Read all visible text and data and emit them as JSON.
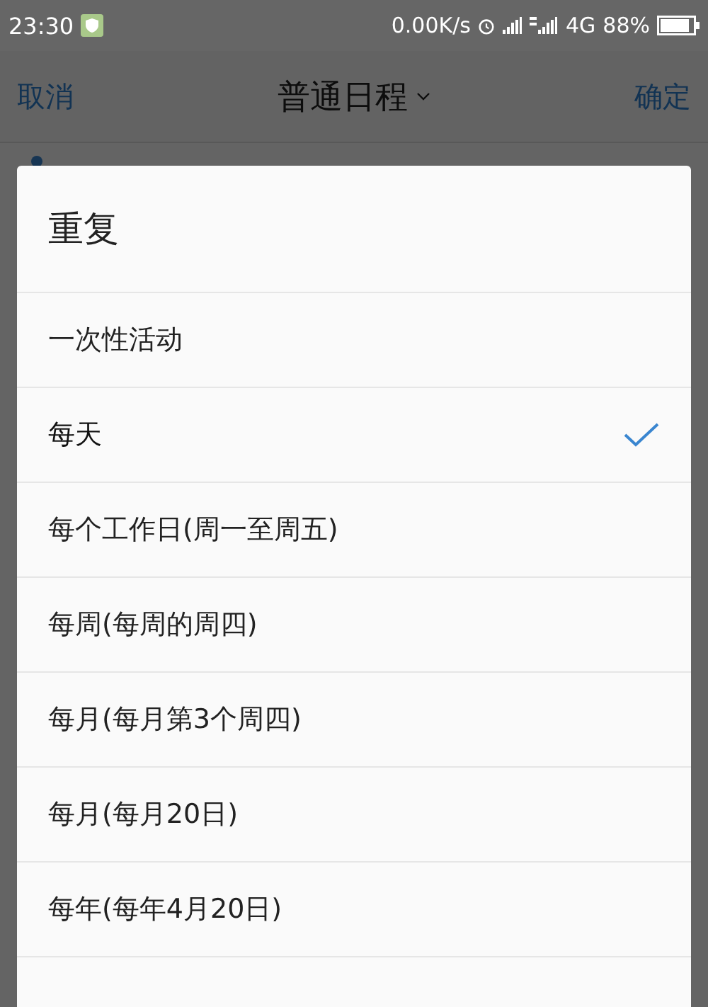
{
  "status_bar": {
    "time": "23:30",
    "net_speed": "0.00K/s",
    "network": "4G",
    "battery": "88%"
  },
  "header": {
    "cancel": "取消",
    "title": "普通日程",
    "confirm": "确定"
  },
  "dialog": {
    "title": "重复",
    "options": [
      {
        "label": "一次性活动",
        "selected": false
      },
      {
        "label": "每天",
        "selected": true
      },
      {
        "label": "每个工作日(周一至周五)",
        "selected": false
      },
      {
        "label": "每周(每周的周四)",
        "selected": false
      },
      {
        "label": "每月(每月第3个周四)",
        "selected": false
      },
      {
        "label": "每月(每月20日)",
        "selected": false
      },
      {
        "label": "每年(每年4月20日)",
        "selected": false
      }
    ]
  }
}
